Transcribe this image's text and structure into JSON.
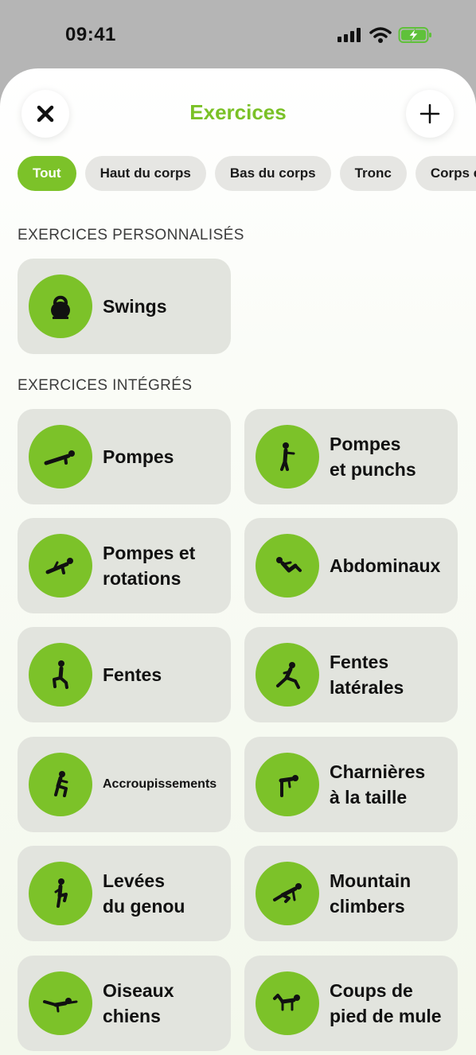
{
  "status_bar": {
    "time": "09:41"
  },
  "header": {
    "title": "Exercices"
  },
  "filters": [
    "Tout",
    "Haut du corps",
    "Bas du corps",
    "Tronc",
    "Corps entier"
  ],
  "sections": {
    "custom_label": "EXERCICES PERSONNALISÉS",
    "builtin_label": "EXERCICES INTÉGRÉS"
  },
  "custom_exercises": [
    {
      "label": "Swings",
      "icon": "kettlebell-icon"
    }
  ],
  "builtin_exercises": [
    {
      "label": "Pompes",
      "icon": "pushup-icon"
    },
    {
      "label": "Pompes\net punchs",
      "icon": "punch-icon"
    },
    {
      "label": "Pompes et\nrotations",
      "icon": "pushup-rotation-icon"
    },
    {
      "label": "Abdominaux",
      "icon": "situp-icon"
    },
    {
      "label": "Fentes",
      "icon": "lunge-icon"
    },
    {
      "label": "Fentes\nlatérales",
      "icon": "side-lunge-icon"
    },
    {
      "label": "Accroupissements",
      "icon": "squat-icon"
    },
    {
      "label": "Charnières\nà la taille",
      "icon": "hip-hinge-icon"
    },
    {
      "label": "Levées\ndu genou",
      "icon": "knee-raise-icon"
    },
    {
      "label": "Mountain\nclimbers",
      "icon": "mountain-climber-icon"
    },
    {
      "label": "Oiseaux\nchiens",
      "icon": "bird-dog-icon"
    },
    {
      "label": "Coups de\npied de mule",
      "icon": "donkey-kick-icon"
    }
  ],
  "colors": {
    "accent": "#7cc229",
    "title": "#7ac127",
    "card": "#e2e4de",
    "chip": "#e6e6e3"
  }
}
